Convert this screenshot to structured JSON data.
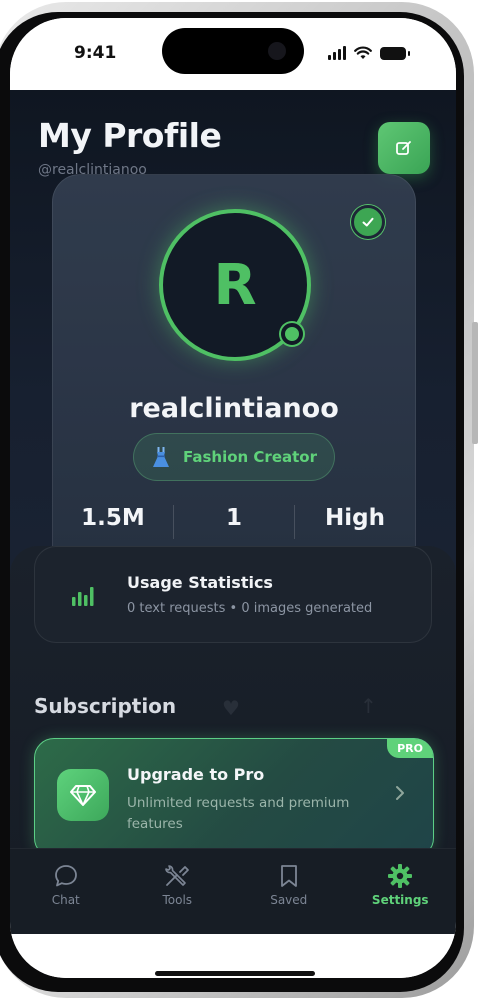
{
  "status_bar": {
    "time": "9:41",
    "icons": [
      "signal-icon",
      "wifi-icon",
      "battery-icon"
    ]
  },
  "header": {
    "title": "My Profile",
    "handle": "@realclintianoo",
    "edit_icon": "edit-icon"
  },
  "profile": {
    "avatar_letter": "R",
    "username": "realclintianoo",
    "badge_icon": "dress-icon",
    "category": "Fashion Creator",
    "verified": true,
    "online": true,
    "stats": [
      "1.5M",
      "1",
      "High"
    ]
  },
  "usage": {
    "title": "Usage Statistics",
    "subtitle": "0 text requests • 0 images generated",
    "icon": "bar-chart-icon"
  },
  "subscription": {
    "section_title": "Subscription",
    "card": {
      "badge": "PRO",
      "title": "Upgrade to Pro",
      "description": "Unlimited requests and premium features",
      "icon": "diamond-icon"
    }
  },
  "tabs": [
    {
      "label": "Chat",
      "icon": "chat-bubble-icon",
      "active": false
    },
    {
      "label": "Tools",
      "icon": "tools-icon",
      "active": false
    },
    {
      "label": "Saved",
      "icon": "bookmark-icon",
      "active": false
    },
    {
      "label": "Settings",
      "icon": "gear-icon",
      "active": true
    }
  ],
  "colors": {
    "accent": "#4fc064",
    "background": "#172030",
    "card": "#1c232d"
  }
}
